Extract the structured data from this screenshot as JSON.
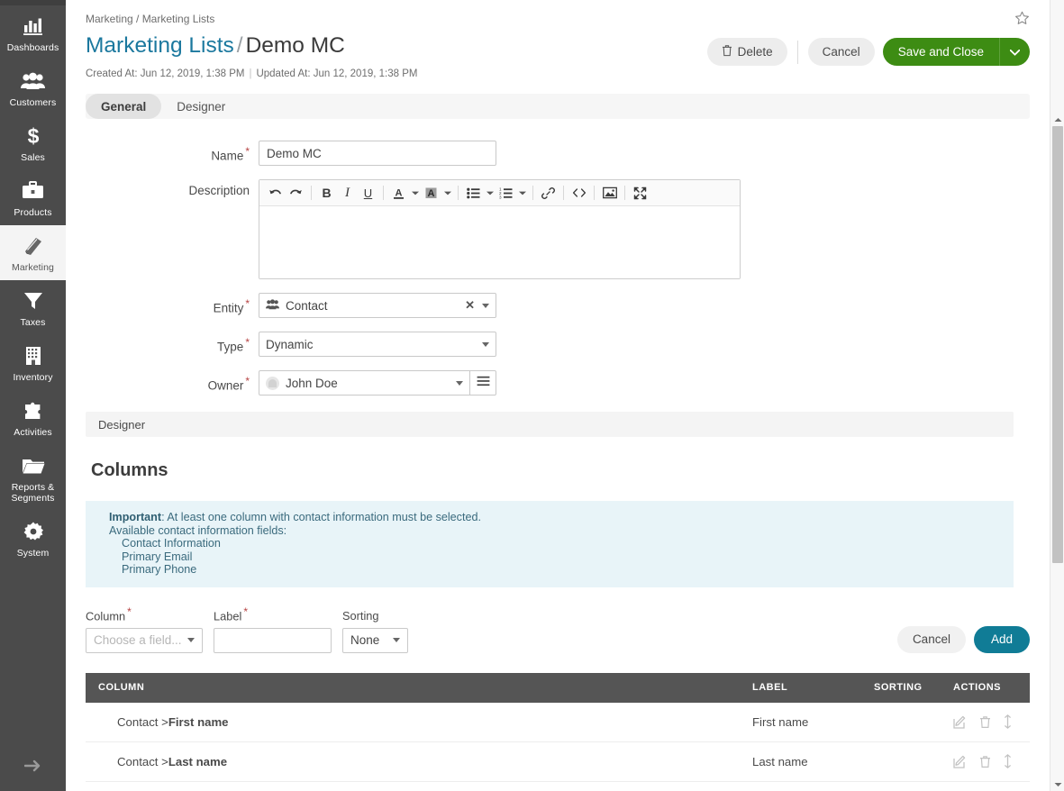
{
  "sidebar": {
    "items": [
      {
        "label": "Dashboards",
        "icon": "chart-bar-icon",
        "active": false
      },
      {
        "label": "Customers",
        "icon": "users-icon",
        "active": false
      },
      {
        "label": "Sales",
        "icon": "dollar-icon",
        "active": false
      },
      {
        "label": "Products",
        "icon": "briefcase-icon",
        "active": false
      },
      {
        "label": "Marketing",
        "icon": "book-icon",
        "active": true
      },
      {
        "label": "Taxes",
        "icon": "funnel-icon",
        "active": false
      },
      {
        "label": "Inventory",
        "icon": "building-icon",
        "active": false
      },
      {
        "label": "Activities",
        "icon": "puzzle-icon",
        "active": false
      },
      {
        "label": "Reports & Segments",
        "icon": "folder-icon",
        "active": false
      },
      {
        "label": "System",
        "icon": "gear-icon",
        "active": false
      }
    ],
    "collapse_icon": "arrow-right-icon"
  },
  "header": {
    "breadcrumb": "Marketing / Marketing Lists",
    "title_link": "Marketing Lists",
    "title_sep": "/",
    "title_current": "Demo MC",
    "created_at": "Created At: Jun 12, 2019, 1:38 PM",
    "updated_at": "Updated At: Jun 12, 2019, 1:38 PM",
    "favorite_icon": "star-icon"
  },
  "actions": {
    "delete_label": "Delete",
    "delete_icon": "trash-icon",
    "cancel_label": "Cancel",
    "save_label": "Save and Close",
    "save_caret_icon": "chevron-down-icon",
    "save_color": "#3d8c13"
  },
  "tabs": [
    {
      "label": "General",
      "active": true
    },
    {
      "label": "Designer",
      "active": false
    }
  ],
  "form": {
    "name": {
      "label": "Name",
      "required": true,
      "value": "Demo MC"
    },
    "description": {
      "label": "Description",
      "required": false,
      "value": "",
      "toolbar": [
        {
          "name": "undo-icon",
          "type": "icon"
        },
        {
          "name": "redo-icon",
          "type": "icon"
        },
        {
          "name": "separator",
          "type": "sep"
        },
        {
          "name": "bold-icon",
          "type": "text",
          "glyph": "B"
        },
        {
          "name": "italic-icon",
          "type": "text",
          "glyph": "I"
        },
        {
          "name": "underline-icon",
          "type": "text",
          "glyph": "U"
        },
        {
          "name": "separator",
          "type": "sep"
        },
        {
          "name": "text-color-icon",
          "type": "icon",
          "caret": true
        },
        {
          "name": "background-color-icon",
          "type": "icon",
          "caret": true
        },
        {
          "name": "separator",
          "type": "sep"
        },
        {
          "name": "unordered-list-icon",
          "type": "icon",
          "caret": true
        },
        {
          "name": "ordered-list-icon",
          "type": "icon",
          "caret": true
        },
        {
          "name": "separator",
          "type": "sep"
        },
        {
          "name": "link-icon",
          "type": "icon"
        },
        {
          "name": "separator",
          "type": "sep"
        },
        {
          "name": "source-code-icon",
          "type": "icon"
        },
        {
          "name": "separator",
          "type": "sep"
        },
        {
          "name": "image-icon",
          "type": "icon"
        },
        {
          "name": "separator",
          "type": "sep"
        },
        {
          "name": "fullscreen-icon",
          "type": "icon"
        }
      ]
    },
    "entity": {
      "label": "Entity",
      "required": true,
      "value": "Contact",
      "icon": "users-icon",
      "clear_icon": "clear-x-icon"
    },
    "type": {
      "label": "Type",
      "required": true,
      "value": "Dynamic"
    },
    "owner": {
      "label": "Owner",
      "required": true,
      "value": "John Doe",
      "avatar": "user-avatar",
      "picker_icon": "list-menu-icon"
    }
  },
  "designer": {
    "band_label": "Designer",
    "section_title": "Columns",
    "alert": {
      "strong": "Important",
      "line1": ": At least one column with contact information must be selected.",
      "line2": "Available contact information fields:",
      "fields": [
        "Contact Information",
        "Primary Email",
        "Primary Phone"
      ]
    },
    "add_form": {
      "column_label": "Column",
      "column_required": true,
      "column_placeholder": "Choose a field...",
      "label_label": "Label",
      "label_required": true,
      "label_value": "",
      "sorting_label": "Sorting",
      "sorting_value": "None",
      "cancel_label": "Cancel",
      "add_label": "Add",
      "add_color": "#107c96"
    },
    "table": {
      "headers": [
        "COLUMN",
        "LABEL",
        "SORTING",
        "ACTIONS"
      ],
      "rows": [
        {
          "entity": "Contact >",
          "field": "First name",
          "label": "First name",
          "sorting": ""
        },
        {
          "entity": "Contact >",
          "field": "Last name",
          "label": "Last name",
          "sorting": ""
        }
      ],
      "row_actions": [
        "edit-icon",
        "delete-icon",
        "reorder-icon"
      ]
    }
  },
  "scrollbar": {
    "up_icon": "caret-up-icon",
    "down_icon": "caret-down-icon"
  }
}
